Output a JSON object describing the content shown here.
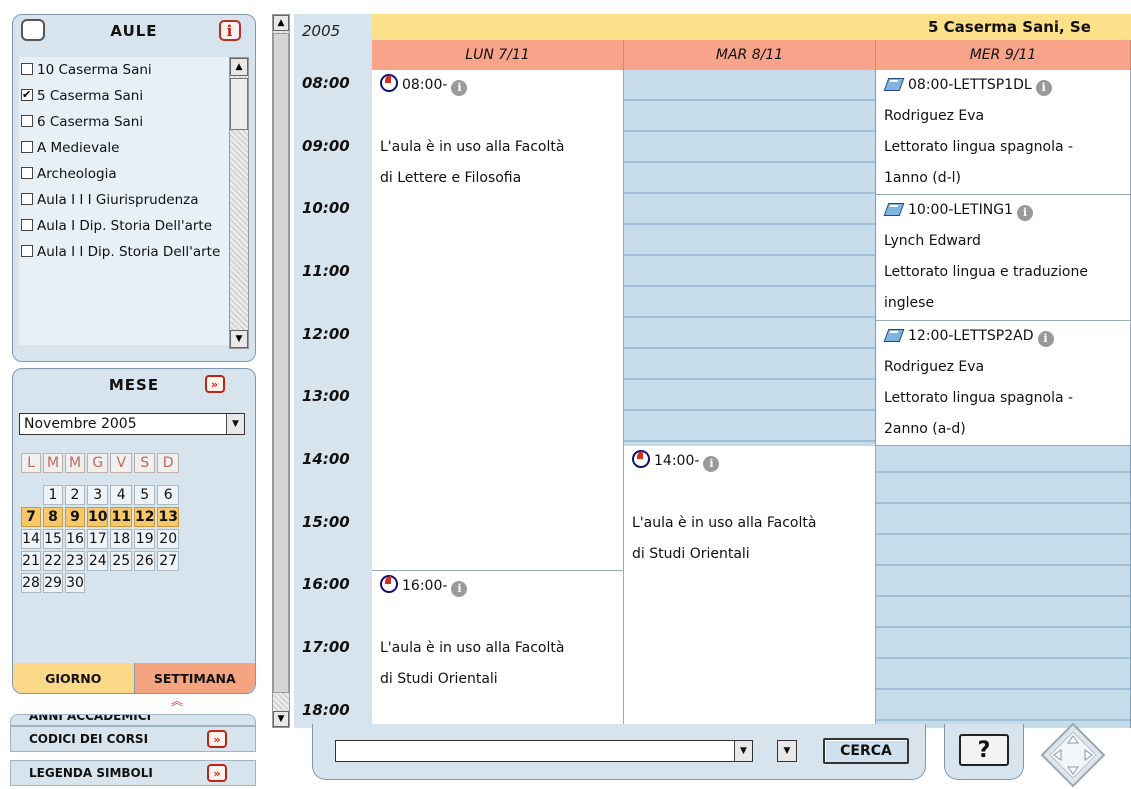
{
  "aule": {
    "title": "AULE",
    "info_label": "i",
    "items": [
      {
        "label": "10 Caserma Sani",
        "checked": false
      },
      {
        "label": "5 Caserma Sani",
        "checked": true
      },
      {
        "label": "6 Caserma Sani",
        "checked": false
      },
      {
        "label": "A Medievale",
        "checked": false
      },
      {
        "label": "Archeologia",
        "checked": false
      },
      {
        "label": "Aula I I I Giurisprudenza",
        "checked": false
      },
      {
        "label": "Aula I Dip. Storia Dell'arte",
        "checked": false
      },
      {
        "label": "Aula I I Dip. Storia Dell'arte",
        "checked": false
      }
    ]
  },
  "mese": {
    "title": "MESE",
    "selected_month": "Novembre 2005",
    "day_headers": [
      "L",
      "M",
      "M",
      "G",
      "V",
      "S",
      "D"
    ],
    "weeks": [
      [
        "",
        "1",
        "2",
        "3",
        "4",
        "5",
        "6"
      ],
      [
        "7",
        "8",
        "9",
        "10",
        "11",
        "12",
        "13"
      ],
      [
        "14",
        "15",
        "16",
        "17",
        "18",
        "19",
        "20"
      ],
      [
        "21",
        "22",
        "23",
        "24",
        "25",
        "26",
        "27"
      ],
      [
        "28",
        "29",
        "30",
        "",
        "",
        "",
        ""
      ]
    ],
    "highlight_week": 1,
    "tab_giorno": "GIORNO",
    "tab_settimana": "SETTIMANA",
    "active_tab": "SETTIMANA"
  },
  "bottom_links": {
    "anni": "ANNI ACCADEMICI",
    "codici": "CODICI DEI CORSI",
    "legenda": "LEGENDA SIMBOLI"
  },
  "schedule": {
    "year": "2005",
    "room": "5 Caserma Sani, Se",
    "days": [
      "LUN 7/11",
      "MAR 8/11",
      "MER 9/11"
    ],
    "times": [
      "08:00",
      "09:00",
      "10:00",
      "11:00",
      "12:00",
      "13:00",
      "14:00",
      "15:00",
      "16:00",
      "17:00",
      "18:00"
    ],
    "events": [
      {
        "col": 0,
        "start": 0,
        "span": 16,
        "icon": "clock",
        "lines": [
          "08:00-",
          "",
          "L'aula è in uso alla Facoltà",
          "di Lettere e Filosofia"
        ]
      },
      {
        "col": 0,
        "start": 16,
        "span": 5,
        "icon": "clock",
        "lines": [
          "16:00-",
          "",
          "L'aula è in uso alla Facoltà",
          "di Studi Orientali"
        ]
      },
      {
        "col": 1,
        "start": 12,
        "span": 9,
        "icon": "clock",
        "lines": [
          "14:00-",
          "",
          "L'aula è in uso alla Facoltà",
          "di Studi Orientali"
        ]
      },
      {
        "col": 2,
        "start": 0,
        "span": 4,
        "icon": "book",
        "lines": [
          "08:00-LETTSP1DL",
          "Rodriguez Eva",
          "Lettorato lingua spagnola -",
          "1anno (d-l)"
        ]
      },
      {
        "col": 2,
        "start": 4,
        "span": 4,
        "icon": "book",
        "lines": [
          "10:00-LETING1",
          "Lynch Edward",
          "Lettorato lingua e traduzione",
          "inglese"
        ]
      },
      {
        "col": 2,
        "start": 8,
        "span": 4,
        "icon": "book",
        "lines": [
          "12:00-LETTSP2AD",
          "Rodriguez Eva",
          "Lettorato lingua spagnola -",
          "2anno (a-d)"
        ]
      }
    ]
  },
  "search": {
    "button_label": "CERCA",
    "help_label": "?"
  },
  "colors": {
    "panel": "#d7e4ee",
    "room_bar": "#fde18a",
    "day_header": "#f7a48a",
    "week_highlight": "#f6c86a",
    "slot": "#c7dcea"
  }
}
